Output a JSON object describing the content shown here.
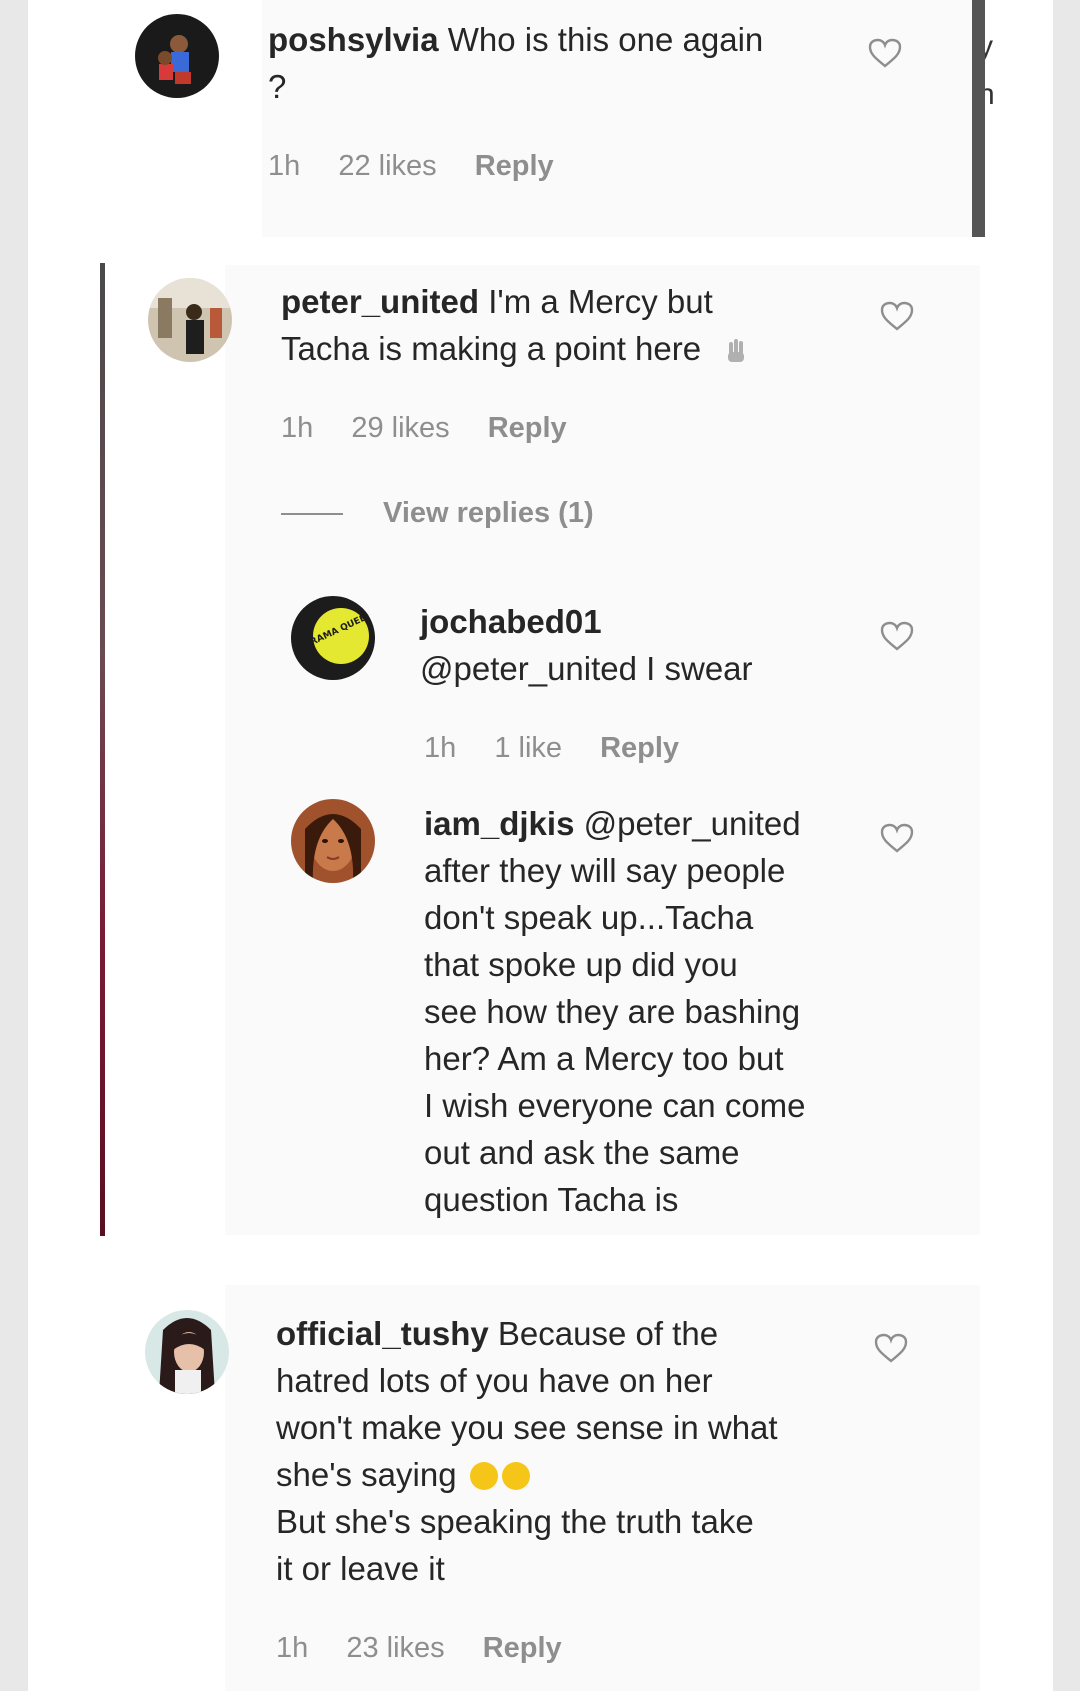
{
  "comments": [
    {
      "username": "poshsylvia",
      "lines": [
        "Who is this one again",
        "?"
      ],
      "time": "1h",
      "likes": "22 likes",
      "reply": "Reply"
    },
    {
      "username": "peter_united",
      "lines": [
        "I'm a Mercy but",
        "Tacha is making a point here"
      ],
      "emoji_name": "waving-hands-emoji",
      "time": "1h",
      "likes": "29 likes",
      "reply": "Reply",
      "view_replies": "View replies (1)",
      "avatar_text": "",
      "replies": [
        {
          "username": "jochabed01",
          "lines": [
            "@peter_united I swear"
          ],
          "time": "1h",
          "likes": "1 like",
          "reply": "Reply",
          "avatar_logo": "DRAMA QUEEN"
        },
        {
          "username": "iam_djkis",
          "lines": [
            "@peter_united",
            "after they will say people",
            "don't speak up...Tacha",
            "that spoke up did you",
            "see how they are bashing",
            "her? Am a Mercy too but",
            "I wish everyone can come",
            "out and ask the same",
            "question Tacha is"
          ]
        }
      ]
    },
    {
      "username": "official_tushy",
      "lines": [
        "Because of the",
        "hatred lots of you have on her",
        "won't make you see sense in what",
        "she's saying",
        "But she's speaking the truth take",
        "it or leave it"
      ],
      "emoji_name": "smiling-face-emoji",
      "time": "1h",
      "likes": "23 likes",
      "reply": "Reply"
    }
  ],
  "edge_peek": [
    "y",
    "h"
  ],
  "colors": {
    "text": "#262626",
    "meta": "#8e8e8e",
    "thread_line": "#7a1a35",
    "block_bg": "#fafafa",
    "page_bg": "#e8e8e8"
  }
}
